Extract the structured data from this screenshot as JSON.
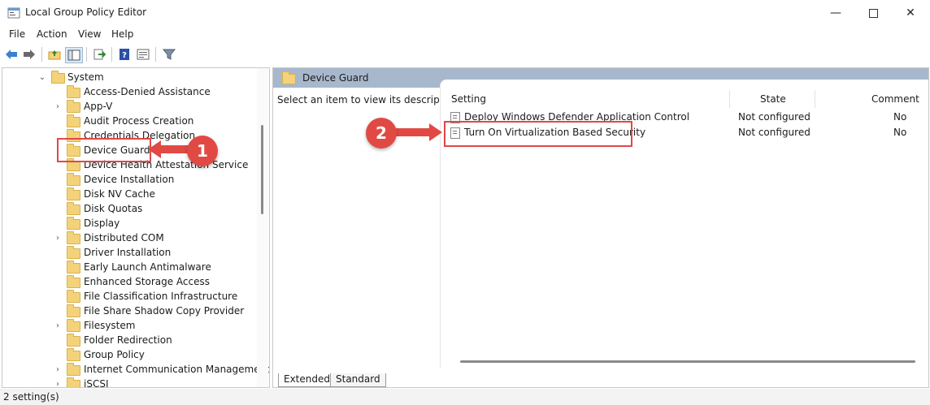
{
  "window": {
    "title": "Local Group Policy Editor"
  },
  "menu": [
    "File",
    "Action",
    "View",
    "Help"
  ],
  "tree": {
    "root": "System",
    "items": [
      "Access-Denied Assistance",
      "App-V",
      "Audit Process Creation",
      "Credentials Delegation",
      "Device Guard",
      "Device Health Attestation Service",
      "Device Installation",
      "Disk NV Cache",
      "Disk Quotas",
      "Display",
      "Distributed COM",
      "Driver Installation",
      "Early Launch Antimalware",
      "Enhanced Storage Access",
      "File Classification Infrastructure",
      "File Share Shadow Copy Provider",
      "Filesystem",
      "Folder Redirection",
      "Group Policy",
      "Internet Communication Management",
      "iSCSI"
    ]
  },
  "right": {
    "header": "Device Guard",
    "description": "Select an item to view its description.",
    "columns": {
      "setting": "Setting",
      "state": "State",
      "comment": "Comment"
    },
    "rows": [
      {
        "setting": "Deploy Windows Defender Application Control",
        "state": "Not configured",
        "comment": "No"
      },
      {
        "setting": "Turn On Virtualization Based Security",
        "state": "Not configured",
        "comment": "No"
      }
    ],
    "tabs": [
      "Extended",
      "Standard"
    ]
  },
  "status": "2 setting(s)",
  "annotations": {
    "badge1": "1",
    "badge2": "2"
  },
  "colors": {
    "annotation": "#e14a44",
    "header": "#a7b8cc",
    "folder": "#f3d27a"
  }
}
